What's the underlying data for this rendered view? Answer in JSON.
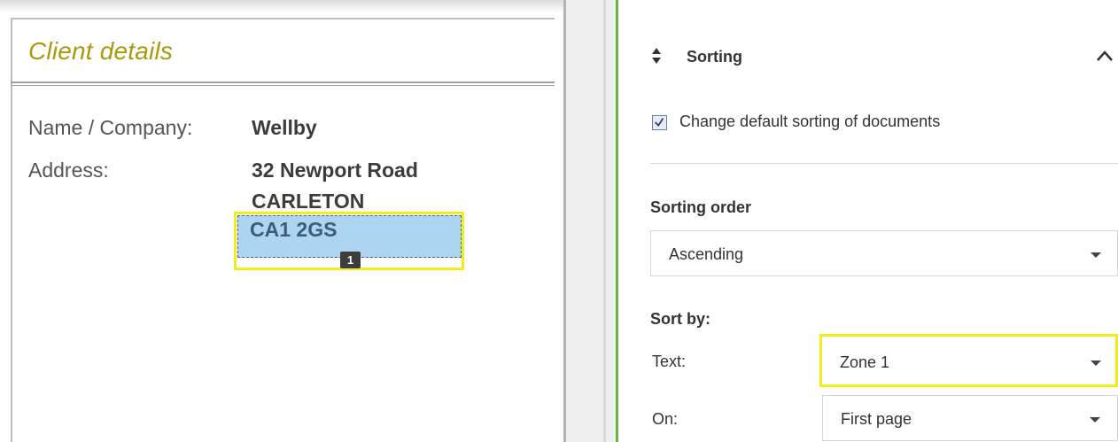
{
  "document": {
    "title": "Client details",
    "fields": [
      {
        "label": "Name / Company:",
        "value": "Wellby"
      },
      {
        "label": "Address:",
        "value_lines": [
          "32 Newport Road",
          "CARLETON"
        ]
      }
    ],
    "zone": {
      "text": "CA1 2GS",
      "badge": "1"
    }
  },
  "panel": {
    "section": {
      "title": "Sorting",
      "icon": "sort-icon",
      "collapse_icon": "chevron-up-icon"
    },
    "checkbox": {
      "label": "Change default sorting of documents",
      "checked": true
    },
    "sorting_order": {
      "label": "Sorting order",
      "value": "Ascending"
    },
    "sort_by": {
      "label": "Sort by:",
      "text_label": "Text:",
      "text_value": "Zone 1",
      "on_label": "On:",
      "on_value": "First page"
    }
  },
  "colors": {
    "title_gold": "#a89a0c",
    "zone_highlight": "#f2ee1e",
    "zone_fill": "#add4f0",
    "accent_green": "#6db33f"
  }
}
